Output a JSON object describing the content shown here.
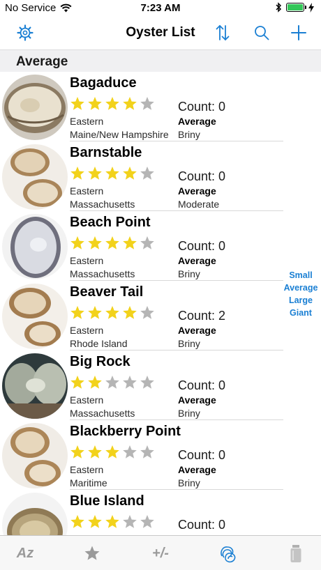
{
  "status_bar": {
    "carrier": "No Service",
    "time": "7:23 AM",
    "battery_level": 1.0
  },
  "nav": {
    "title": "Oyster List",
    "settings_icon": "gear-icon",
    "sort_icon": "sort-arrows-icon",
    "search_icon": "search-icon",
    "add_icon": "plus-icon"
  },
  "section": {
    "title": "Average"
  },
  "oysters": [
    {
      "name": "Bagaduce",
      "rating": 4,
      "count": "Count: 0",
      "region": "Eastern",
      "size": "Average",
      "location": "Maine/New Hampshire",
      "salinity": "Briny"
    },
    {
      "name": "Barnstable",
      "rating": 4,
      "count": "Count: 0",
      "region": "Eastern",
      "size": "Average",
      "location": "Massachusetts",
      "salinity": "Moderate"
    },
    {
      "name": "Beach Point",
      "rating": 4,
      "count": "Count: 0",
      "region": "Eastern",
      "size": "Average",
      "location": "Massachusetts",
      "salinity": "Briny"
    },
    {
      "name": "Beaver Tail",
      "rating": 4,
      "count": "Count: 2",
      "region": "Eastern",
      "size": "Average",
      "location": "Rhode Island",
      "salinity": "Briny"
    },
    {
      "name": "Big Rock",
      "rating": 2,
      "count": "Count: 0",
      "region": "Eastern",
      "size": "Average",
      "location": "Massachusetts",
      "salinity": "Briny"
    },
    {
      "name": "Blackberry Point",
      "rating": 3,
      "count": "Count: 0",
      "region": "Eastern",
      "size": "Average",
      "location": "Maritime",
      "salinity": "Briny"
    },
    {
      "name": "Blue Island",
      "rating": 3,
      "count": "Count: 0",
      "region": "",
      "size": "",
      "location": "",
      "salinity": ""
    }
  ],
  "section_index": [
    "Small",
    "Average",
    "Large",
    "Giant"
  ],
  "tabs": {
    "az": "Az",
    "star_icon": "star-icon",
    "plus_minus": "+/-",
    "oyster_icon": "oyster-icon",
    "shaker_icon": "salt-shaker-icon"
  },
  "colors": {
    "accent": "#1a7fd3",
    "star_on": "#f2d21b",
    "star_off": "#b5b5b5",
    "tab_inactive": "#9a9a9a"
  }
}
